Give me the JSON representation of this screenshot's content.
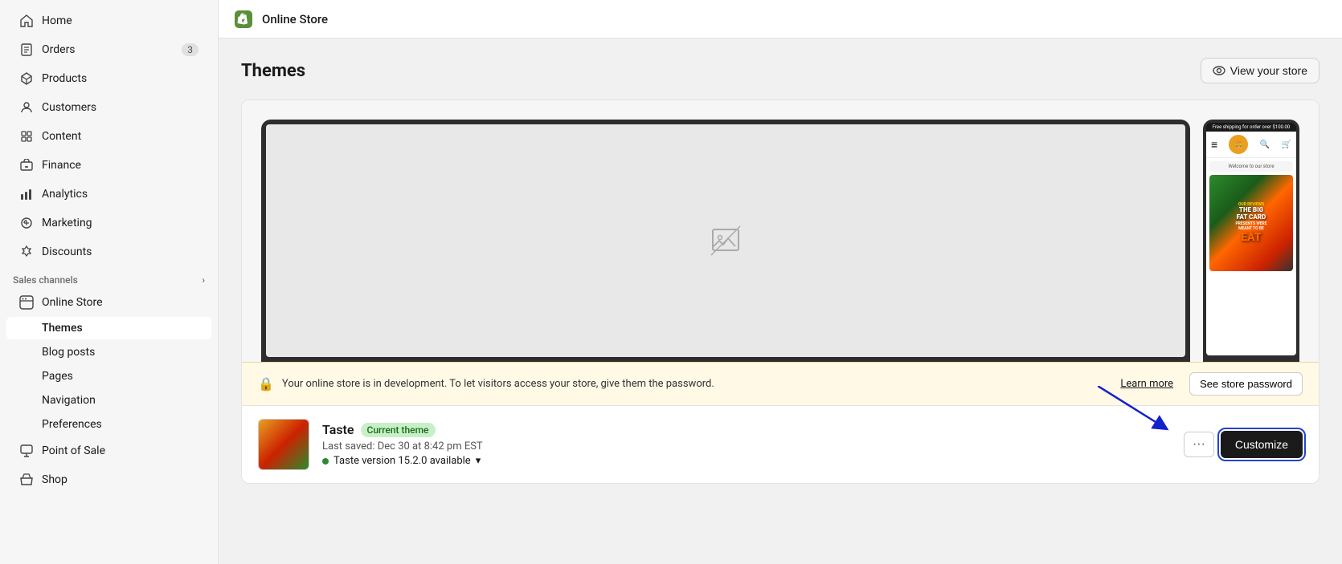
{
  "sidebar": {
    "nav_items": [
      {
        "id": "home",
        "label": "Home",
        "icon": "home"
      },
      {
        "id": "orders",
        "label": "Orders",
        "icon": "orders",
        "badge": "3"
      },
      {
        "id": "products",
        "label": "Products",
        "icon": "products"
      },
      {
        "id": "customers",
        "label": "Customers",
        "icon": "customers"
      },
      {
        "id": "content",
        "label": "Content",
        "icon": "content"
      },
      {
        "id": "finance",
        "label": "Finance",
        "icon": "finance"
      },
      {
        "id": "analytics",
        "label": "Analytics",
        "icon": "analytics"
      },
      {
        "id": "marketing",
        "label": "Marketing",
        "icon": "marketing"
      },
      {
        "id": "discounts",
        "label": "Discounts",
        "icon": "discounts"
      }
    ],
    "sales_channels_label": "Sales channels",
    "online_store_label": "Online Store",
    "themes_label": "Themes",
    "sub_items": [
      {
        "id": "blog-posts",
        "label": "Blog posts"
      },
      {
        "id": "pages",
        "label": "Pages"
      },
      {
        "id": "navigation",
        "label": "Navigation"
      },
      {
        "id": "preferences",
        "label": "Preferences"
      }
    ],
    "point_of_sale_label": "Point of Sale",
    "shop_label": "Shop"
  },
  "topbar": {
    "store_name": "Online Store",
    "logo_icon": "shopify-logo"
  },
  "page": {
    "title": "Themes",
    "view_store_btn": "View your store"
  },
  "dev_notice": {
    "message": "Your online store is in development. To let visitors access your store, give them the password.",
    "learn_more": "Learn more",
    "see_password": "See store password"
  },
  "current_theme": {
    "name": "Taste",
    "badge": "Current theme",
    "saved": "Last saved: Dec 30 at 8:42 pm EST",
    "version_text": "Taste version 15.2.0 available",
    "more_btn": "···",
    "customize_btn": "Customize"
  },
  "mobile_preview": {
    "banner": "Free shipping for order over $100.00",
    "welcome": "Welcome to our store",
    "promo_line1": "THE BIG",
    "promo_line2": "FAT CARD",
    "promo_line3": "PRESENTS WERE",
    "promo_line4": "MEANT TO BE",
    "promo_line5": "EAT"
  }
}
